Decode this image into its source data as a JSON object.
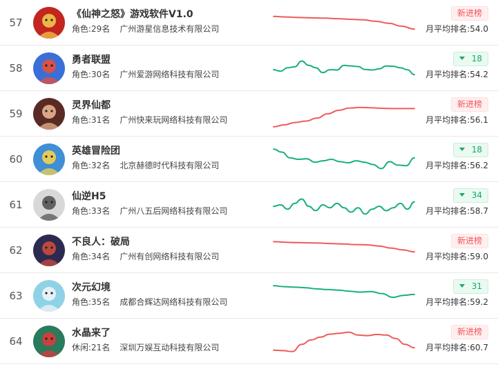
{
  "rows": [
    {
      "rank": "57",
      "name": "《仙神之怒》游戏软件V1.0",
      "category": "角色:29名",
      "company": "广州游星信息技术有限公司",
      "badge_type": "new",
      "badge": "新进榜",
      "avg": "月平均排名:54.0",
      "trend_color": "#ef5a5a",
      "avatar": {
        "bg": "#c2261e",
        "fg": "#f2c64a",
        "icon": "warrior-face-icon"
      },
      "trend": [
        0.72,
        0.7,
        0.68,
        0.67,
        0.66,
        0.64,
        0.62,
        0.6,
        0.55,
        0.48,
        0.38,
        0.28
      ]
    },
    {
      "rank": "58",
      "name": "勇者联盟",
      "category": "角色:30名",
      "company": "广州爱游网络科技有限公司",
      "badge_type": "up",
      "badge": "18",
      "avg": "月平均排名:54.2",
      "trend_color": "#17b07a",
      "avatar": {
        "bg": "#3a6fd8",
        "fg": "#e94f3a",
        "icon": "bird-hero-icon"
      },
      "trend": [
        0.45,
        0.4,
        0.52,
        0.55,
        0.75,
        0.6,
        0.52,
        0.35,
        0.45,
        0.44,
        0.6,
        0.58,
        0.56,
        0.46,
        0.44,
        0.48,
        0.58,
        0.57,
        0.52,
        0.45,
        0.28
      ]
    },
    {
      "rank": "59",
      "name": "灵界仙都",
      "category": "角色:31名",
      "company": "广州快来玩网络科技有限公司",
      "badge_type": "new",
      "badge": "新进榜",
      "avg": "月平均排名:56.1",
      "trend_color": "#ef5a5a",
      "avatar": {
        "bg": "#5a2a24",
        "fg": "#e7b38f",
        "icon": "fairy-portrait-icon"
      },
      "trend": [
        0.05,
        0.12,
        0.2,
        0.25,
        0.35,
        0.5,
        0.62,
        0.7,
        0.72,
        0.71,
        0.69,
        0.68,
        0.68,
        0.68
      ]
    },
    {
      "rank": "60",
      "name": "英雄冒险团",
      "category": "角色:32名",
      "company": "北京赫德时代科技有限公司",
      "badge_type": "up",
      "badge": "18",
      "avg": "月平均排名:56.2",
      "trend_color": "#17b07a",
      "avatar": {
        "bg": "#3e8fd6",
        "fg": "#f5d24a",
        "icon": "adventurer-face-icon"
      },
      "trend": [
        0.85,
        0.75,
        0.55,
        0.5,
        0.52,
        0.4,
        0.45,
        0.5,
        0.42,
        0.38,
        0.45,
        0.4,
        0.32,
        0.18,
        0.42,
        0.3,
        0.28,
        0.55
      ]
    },
    {
      "rank": "61",
      "name": "仙逆H5",
      "category": "角色:33名",
      "company": "广州八五后网络科技有限公司",
      "badge_type": "up",
      "badge": "34",
      "avg": "月平均排名:58.7",
      "trend_color": "#17b07a",
      "avatar": {
        "bg": "#d8d8d8",
        "fg": "#555555",
        "icon": "ink-immortal-icon"
      },
      "trend": [
        0.45,
        0.5,
        0.35,
        0.55,
        0.7,
        0.45,
        0.3,
        0.5,
        0.4,
        0.55,
        0.4,
        0.25,
        0.4,
        0.18,
        0.35,
        0.45,
        0.3,
        0.4,
        0.55,
        0.35,
        0.6
      ]
    },
    {
      "rank": "62",
      "name": "不良人：破局",
      "category": "角色:34名",
      "company": "广州有创网络科技有限公司",
      "badge_type": "new",
      "badge": "新进榜",
      "avg": "月平均排名:59.0",
      "trend_color": "#ef5a5a",
      "avatar": {
        "bg": "#2d2a52",
        "fg": "#c94c3c",
        "icon": "swordsman-icon"
      },
      "trend": [
        0.8,
        0.78,
        0.77,
        0.76,
        0.75,
        0.73,
        0.72,
        0.7,
        0.69,
        0.65,
        0.58,
        0.52,
        0.45
      ]
    },
    {
      "rank": "63",
      "name": "次元幻境",
      "category": "角色:35名",
      "company": "成都合辉达网络科技有限公司",
      "badge_type": "up",
      "badge": "31",
      "avg": "月平均排名:59.2",
      "trend_color": "#17b07a",
      "avatar": {
        "bg": "#8fd2e6",
        "fg": "#f0f4f8",
        "icon": "anime-girl-icon"
      },
      "trend": [
        0.85,
        0.82,
        0.8,
        0.78,
        0.74,
        0.72,
        0.7,
        0.66,
        0.63,
        0.65,
        0.58,
        0.45,
        0.52,
        0.55
      ]
    },
    {
      "rank": "64",
      "name": "水晶来了",
      "category": "休闲:21名",
      "company": "深圳万娱互动科技有限公司",
      "badge_type": "new",
      "badge": "新进榜",
      "avg": "月平均排名:60.7",
      "trend_color": "#ef5a5a",
      "avatar": {
        "bg": "#2a7a5c",
        "fg": "#d93b3b",
        "icon": "girl-portrait-icon"
      },
      "trend": [
        0.2,
        0.18,
        0.15,
        0.4,
        0.55,
        0.65,
        0.75,
        0.78,
        0.82,
        0.72,
        0.7,
        0.74,
        0.72,
        0.6,
        0.4,
        0.28
      ]
    }
  ]
}
